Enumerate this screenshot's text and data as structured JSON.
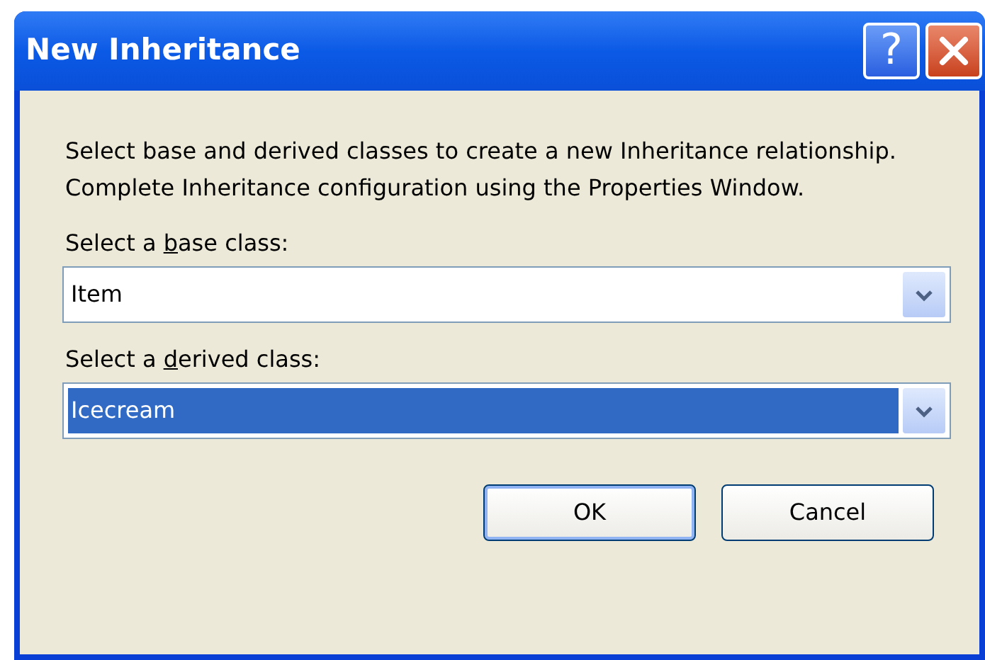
{
  "window": {
    "title": "New Inheritance"
  },
  "title_buttons": [
    {
      "kind": "help",
      "label": "?"
    },
    {
      "kind": "close"
    }
  ],
  "description": "Select base and derived classes to create a new Inheritance relationship.  Complete Inheritance configuration using the Properties Window.",
  "fields": [
    {
      "label": {
        "before": "Select a ",
        "access_key": "b",
        "after": "ase class:"
      },
      "value": "Item",
      "focused": false
    },
    {
      "label": {
        "before": "Select a ",
        "access_key": "d",
        "after": "erived class:"
      },
      "value": "Icecream",
      "focused": true
    }
  ],
  "buttons": [
    {
      "label": "OK",
      "default": true
    },
    {
      "label": "Cancel",
      "default": false
    }
  ]
}
